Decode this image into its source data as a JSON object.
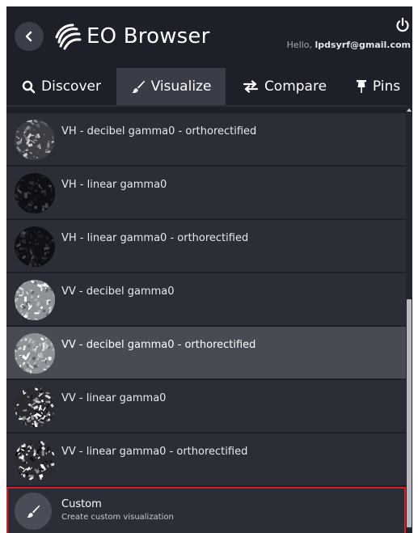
{
  "header": {
    "title": "EO Browser",
    "greeting_prefix": "Hello, ",
    "user_email": "lpdsyrf@gmail.com"
  },
  "tabs": [
    {
      "label": "Discover",
      "icon": "search-icon",
      "active": false
    },
    {
      "label": "Visualize",
      "icon": "brush-icon",
      "active": true
    },
    {
      "label": "Compare",
      "icon": "compare-arrows-icon",
      "active": false
    },
    {
      "label": "Pins",
      "icon": "pin-icon",
      "active": false
    }
  ],
  "layers": [
    {
      "label": "VH - decibel gamma0 - orthorectified",
      "thumb": "sar-dark-grey",
      "selected": false
    },
    {
      "label": "VH - linear gamma0",
      "thumb": "sar-black",
      "selected": false
    },
    {
      "label": "VH - linear gamma0 - orthorectified",
      "thumb": "sar-black",
      "selected": false
    },
    {
      "label": "VV - decibel gamma0",
      "thumb": "sar-light-grey",
      "selected": false
    },
    {
      "label": "VV - decibel gamma0 - orthorectified",
      "thumb": "sar-light-grey",
      "selected": true
    },
    {
      "label": "VV - linear gamma0",
      "thumb": "sar-contrast",
      "selected": false
    },
    {
      "label": "VV - linear gamma0 - orthorectified",
      "thumb": "sar-contrast",
      "selected": false
    }
  ],
  "custom": {
    "title": "Custom",
    "subtitle": "Create custom visualization",
    "icon": "brush-icon"
  },
  "colors": {
    "panel": "#1e2029",
    "item": "#2b2d37",
    "selected": "#494b54",
    "highlight_border": "#d4212a"
  }
}
